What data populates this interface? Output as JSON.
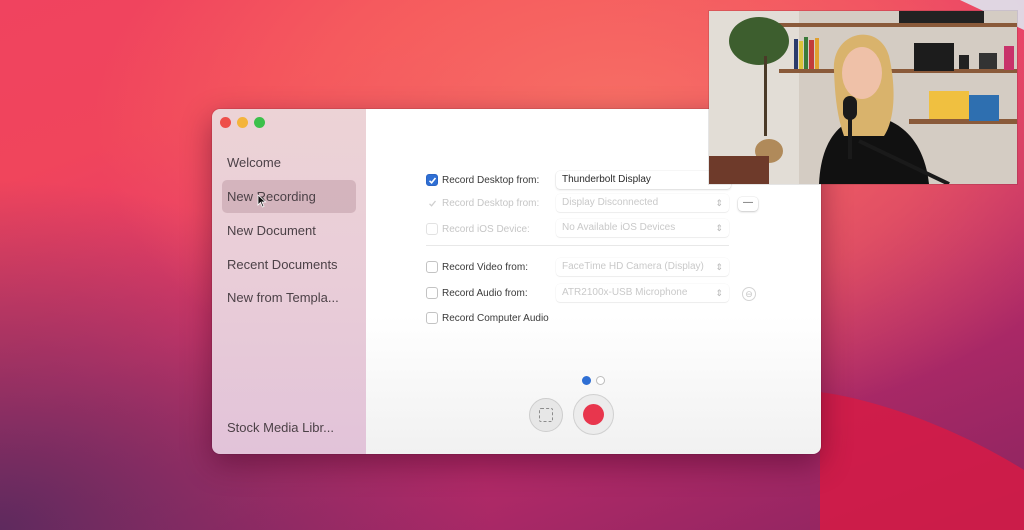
{
  "window": {
    "traffic_lights": [
      "close",
      "minimize",
      "zoom"
    ],
    "sidebar": {
      "items": [
        {
          "label": "Welcome",
          "active": false
        },
        {
          "label": "New Recording",
          "active": true
        },
        {
          "label": "New Document",
          "active": false
        },
        {
          "label": "Recent Documents",
          "active": false
        },
        {
          "label": "New from Templa..."
        }
      ],
      "footer_item": {
        "label": "Stock Media Libr..."
      }
    },
    "recording_options": [
      {
        "label": "Record Desktop from:",
        "checked": true,
        "enabled": true,
        "value": "Thunderbolt Display"
      },
      {
        "label": "Record Desktop from:",
        "checked": true,
        "enabled": false,
        "value": "Display Disconnected",
        "remove_button": "—"
      },
      {
        "label": "Record iOS Device:",
        "checked": false,
        "enabled": false,
        "value": "No Available iOS Devices"
      },
      {
        "label": "Record Video from:",
        "checked": false,
        "enabled": true,
        "value": "FaceTime HD Camera (Display)"
      },
      {
        "label": "Record Audio from:",
        "checked": false,
        "enabled": true,
        "value": "ATR2100x-USB Microphone",
        "extra_button": "⊖"
      },
      {
        "label": "Record Computer Audio",
        "checked": false,
        "enabled": true
      }
    ],
    "pagination": {
      "current": 1,
      "total": 2
    },
    "buttons": {
      "screen_select": "select-area",
      "record": "record"
    }
  },
  "overlay": {
    "webcam": "presenter webcam video"
  },
  "colors": {
    "accent_blue": "#2f6fd4",
    "record_red": "#e8364d",
    "close_red": "#ee4f4a",
    "minimize_yellow": "#f4b43b",
    "zoom_green": "#3cc04a"
  }
}
